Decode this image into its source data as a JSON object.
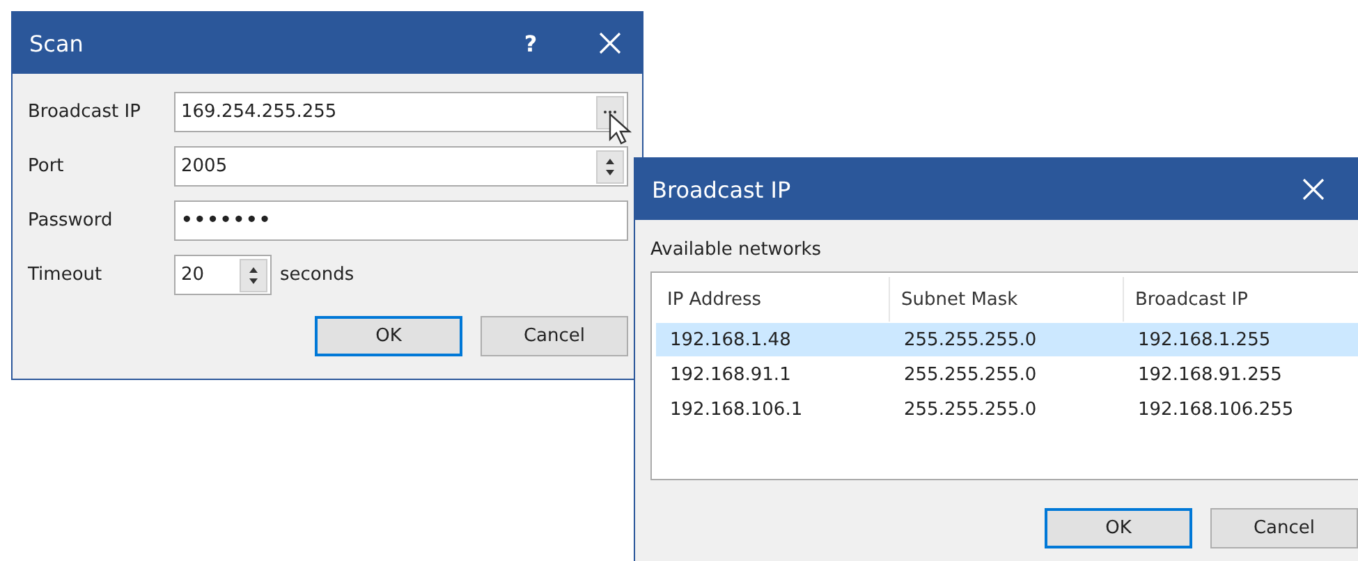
{
  "scan_dialog": {
    "title": "Scan",
    "help": "?",
    "fields": [
      {
        "kind": "browse",
        "label": "Broadcast IP",
        "value": "169.254.255.255"
      },
      {
        "kind": "spin",
        "label": "Port",
        "value": "2005"
      },
      {
        "kind": "text",
        "label": "Password",
        "value": "•••••••"
      },
      {
        "kind": "shortspin",
        "label": "Timeout",
        "value": "20",
        "suffix": "seconds"
      }
    ],
    "buttons": [
      {
        "label": "OK",
        "default": true
      },
      {
        "label": "Cancel",
        "default": false
      }
    ]
  },
  "broadcast_dialog": {
    "title": "Broadcast IP",
    "list_label": "Available networks",
    "columns": [
      "IP Address",
      "Subnet Mask",
      "Broadcast IP"
    ],
    "rows": [
      {
        "cells": [
          "192.168.1.48",
          "255.255.255.0",
          "192.168.1.255"
        ],
        "selected": true
      },
      {
        "cells": [
          "192.168.91.1",
          "255.255.255.0",
          "192.168.91.255"
        ],
        "selected": false
      },
      {
        "cells": [
          "192.168.106.1",
          "255.255.255.0",
          "192.168.106.255"
        ],
        "selected": false
      }
    ],
    "buttons": [
      {
        "label": "OK",
        "default": true
      },
      {
        "label": "Cancel",
        "default": false
      }
    ]
  }
}
